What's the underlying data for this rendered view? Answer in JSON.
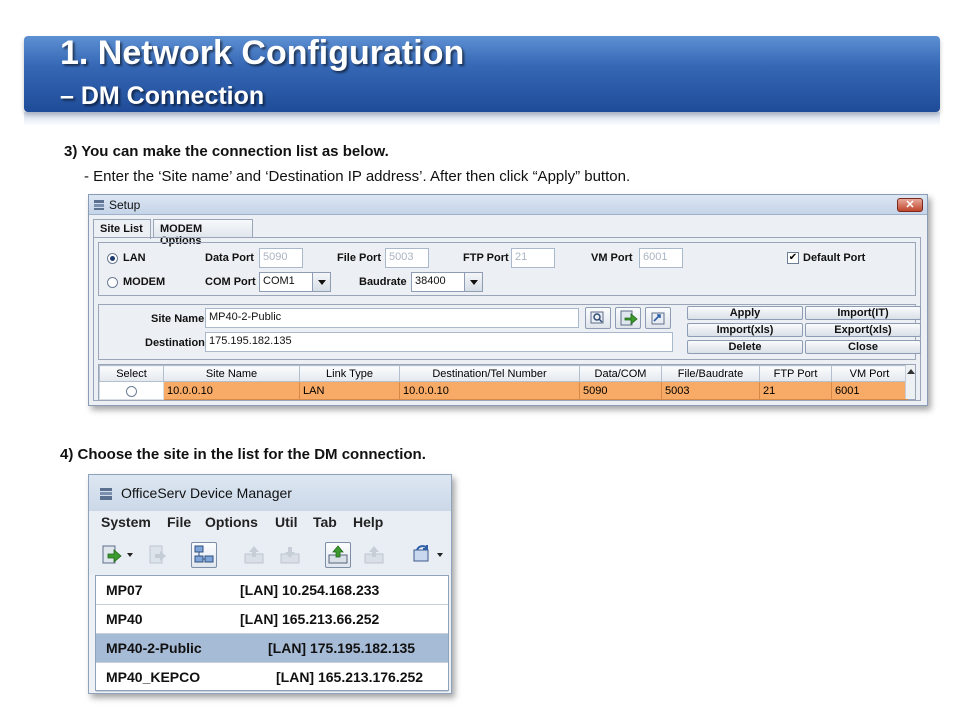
{
  "slide": {
    "title_line1": "1. Network Configuration",
    "title_line2": "– DM Connection",
    "step3": "3) You can make the connection list as below.",
    "step3_sub": "- Enter the ‘Site name’ and ‘Destination IP address’. After then click “Apply” button.",
    "step4": "4) Choose the site in the list for the DM connection."
  },
  "setup": {
    "title": "Setup",
    "close": "✕",
    "tabs": [
      "Site List",
      "MODEM Options"
    ],
    "lan": {
      "label": "LAN",
      "data_port_label": "Data Port",
      "data_port": "5090",
      "file_port_label": "File Port",
      "file_port": "5003",
      "ftp_port_label": "FTP Port",
      "ftp_port": "21",
      "vm_port_label": "VM Port",
      "vm_port": "6001",
      "default_port_label": "Default Port",
      "default_port_checked": "✔"
    },
    "modem": {
      "label": "MODEM",
      "com_port_label": "COM Port",
      "com_port": "COM1",
      "baudrate_label": "Baudrate",
      "baudrate": "38400"
    },
    "site_name_label": "Site Name",
    "site_name": "MP40-2-Public",
    "destination_label": "Destination",
    "destination": "175.195.182.135",
    "buttons": {
      "apply": "Apply",
      "import_it": "Import(IT)",
      "import_xls": "Import(xls)",
      "export_xls": "Export(xls)",
      "delete": "Delete",
      "close": "Close"
    },
    "table": {
      "columns": [
        "Select",
        "Site Name",
        "Link Type",
        "Destination/Tel Number",
        "Data/COM",
        "File/Baudrate",
        "FTP Port",
        "VM Port"
      ],
      "rows": [
        [
          "",
          "10.0.0.10",
          "LAN",
          "10.0.0.10",
          "5090",
          "5003",
          "21",
          "6001"
        ]
      ]
    }
  },
  "device_manager": {
    "title": "OfficeServ Device Manager",
    "menu": [
      "System",
      "File",
      "Options",
      "Util",
      "Tab",
      "Help"
    ],
    "sites": [
      {
        "name": "MP07",
        "addr": "[LAN] 10.254.168.233",
        "selected": false
      },
      {
        "name": "MP40",
        "addr": "[LAN] 165.213.66.252",
        "selected": false
      },
      {
        "name": "MP40-2-Public",
        "addr": "[LAN] 175.195.182.135",
        "selected": true
      },
      {
        "name": "MP40_KEPCO",
        "addr": "[LAN] 165.213.176.252",
        "selected": false
      }
    ]
  },
  "colors": {
    "header_blue": "#3567b5",
    "row_highlight_orange": "#f7ab66",
    "selected_row_blue": "#a6bbd6"
  }
}
